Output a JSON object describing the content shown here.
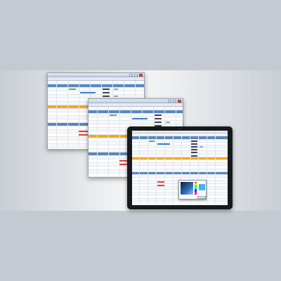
{
  "colors": {
    "background": "#c4cad1",
    "group_row": "#5b86c0",
    "selected_row": "#f4a623",
    "header_row": "#e6ebf1",
    "status_green": "#54b948",
    "status_red": "#e03c31",
    "tablet_bezel": "#17191c",
    "color_picker_gradient": "#2f6fb5",
    "color_picker_swatch": "#45b4e8"
  },
  "windows": [
    {
      "name": "desktop-window-back",
      "icon": "app-icon"
    },
    {
      "name": "desktop-window-middle",
      "icon": "app-icon"
    }
  ],
  "tablet": {
    "name": "tablet-device",
    "popup": "color-picker-popup"
  }
}
